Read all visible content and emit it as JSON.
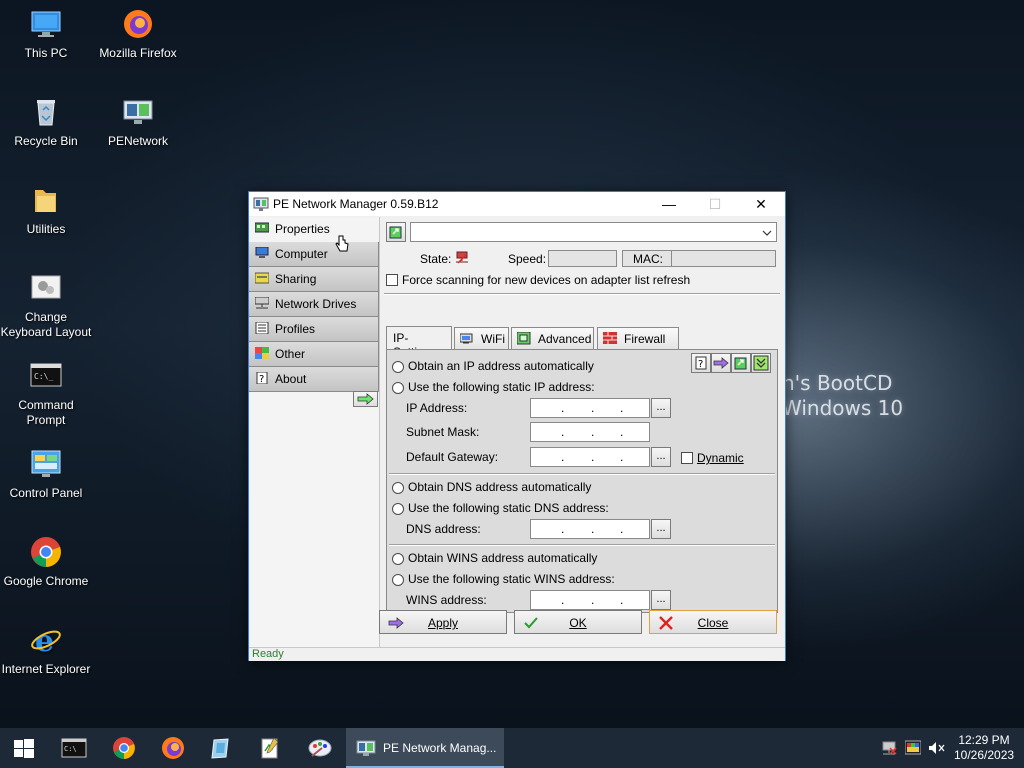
{
  "desktop": {
    "icons": [
      {
        "label": "This PC",
        "icon": "this-pc-icon"
      },
      {
        "label": "Mozilla Firefox",
        "icon": "firefox-icon"
      },
      {
        "label": "Recycle Bin",
        "icon": "recycle-bin-icon"
      },
      {
        "label": "PENetwork",
        "icon": "penetwork-icon"
      },
      {
        "label": "Utilities",
        "icon": "folder-icon"
      },
      {
        "label": "Change Keyboard Layout",
        "icon": "keyboard-layout-icon"
      },
      {
        "label": "Command Prompt",
        "icon": "cmd-icon"
      },
      {
        "label": "Control Panel",
        "icon": "control-panel-icon"
      },
      {
        "label": "Google Chrome",
        "icon": "chrome-icon"
      },
      {
        "label": "Internet Explorer",
        "icon": "ie-icon"
      }
    ],
    "wallpaper_text": {
      "line1": "n's BootCD",
      "line2": "Windows 10"
    }
  },
  "window": {
    "title": "PE Network Manager 0.59.B12",
    "controls": {
      "minimize": "—",
      "maximize": "☐",
      "close": "✕"
    },
    "nav": [
      {
        "label": "Properties",
        "icon": "network-card-icon",
        "active": true
      },
      {
        "label": "Computer",
        "icon": "computer-icon"
      },
      {
        "label": "Sharing",
        "icon": "sharing-icon"
      },
      {
        "label": "Network Drives",
        "icon": "network-drive-icon"
      },
      {
        "label": "Profiles",
        "icon": "profiles-icon"
      },
      {
        "label": "Other",
        "icon": "other-icon"
      },
      {
        "label": "About",
        "icon": "about-icon"
      }
    ],
    "adapter_select": {
      "value": ""
    },
    "state_label": "State:",
    "speed_label": "Speed:",
    "mac_label": "MAC:",
    "force_scan_label": "Force scanning for new devices on adapter list refresh",
    "tabs": [
      {
        "label": "IP-Settings",
        "active": true
      },
      {
        "label": "WiFi",
        "icon": "wifi-icon"
      },
      {
        "label": "Advanced",
        "icon": "advanced-icon"
      },
      {
        "label": "Firewall",
        "icon": "firewall-icon"
      }
    ],
    "ip": {
      "obtain_auto": "Obtain an IP address automatically",
      "use_static": "Use the following static IP address:",
      "ip_label": "IP Address:",
      "mask_label": "Subnet Mask:",
      "gateway_label": "Default Gateway:",
      "dynamic_label": "Dynamic",
      "dots_label": "..."
    },
    "dns": {
      "obtain_auto": "Obtain DNS address automatically",
      "use_static": "Use the following static DNS address:",
      "dns_label": "DNS address:"
    },
    "wins": {
      "obtain_auto": "Obtain WINS address automatically",
      "use_static": "Use the following static WINS address:",
      "wins_label": "WINS address:"
    },
    "buttons": {
      "apply": "Apply",
      "ok": "OK",
      "close": "Close"
    },
    "status": "Ready"
  },
  "taskbar": {
    "active_app": "PE Network Manag...",
    "clock_time": "12:29 PM",
    "clock_date": "10/26/2023"
  },
  "colors": {
    "accent": "#3a7bd5",
    "taskbar": "#1d2936",
    "status_text": "#2e7d32"
  }
}
